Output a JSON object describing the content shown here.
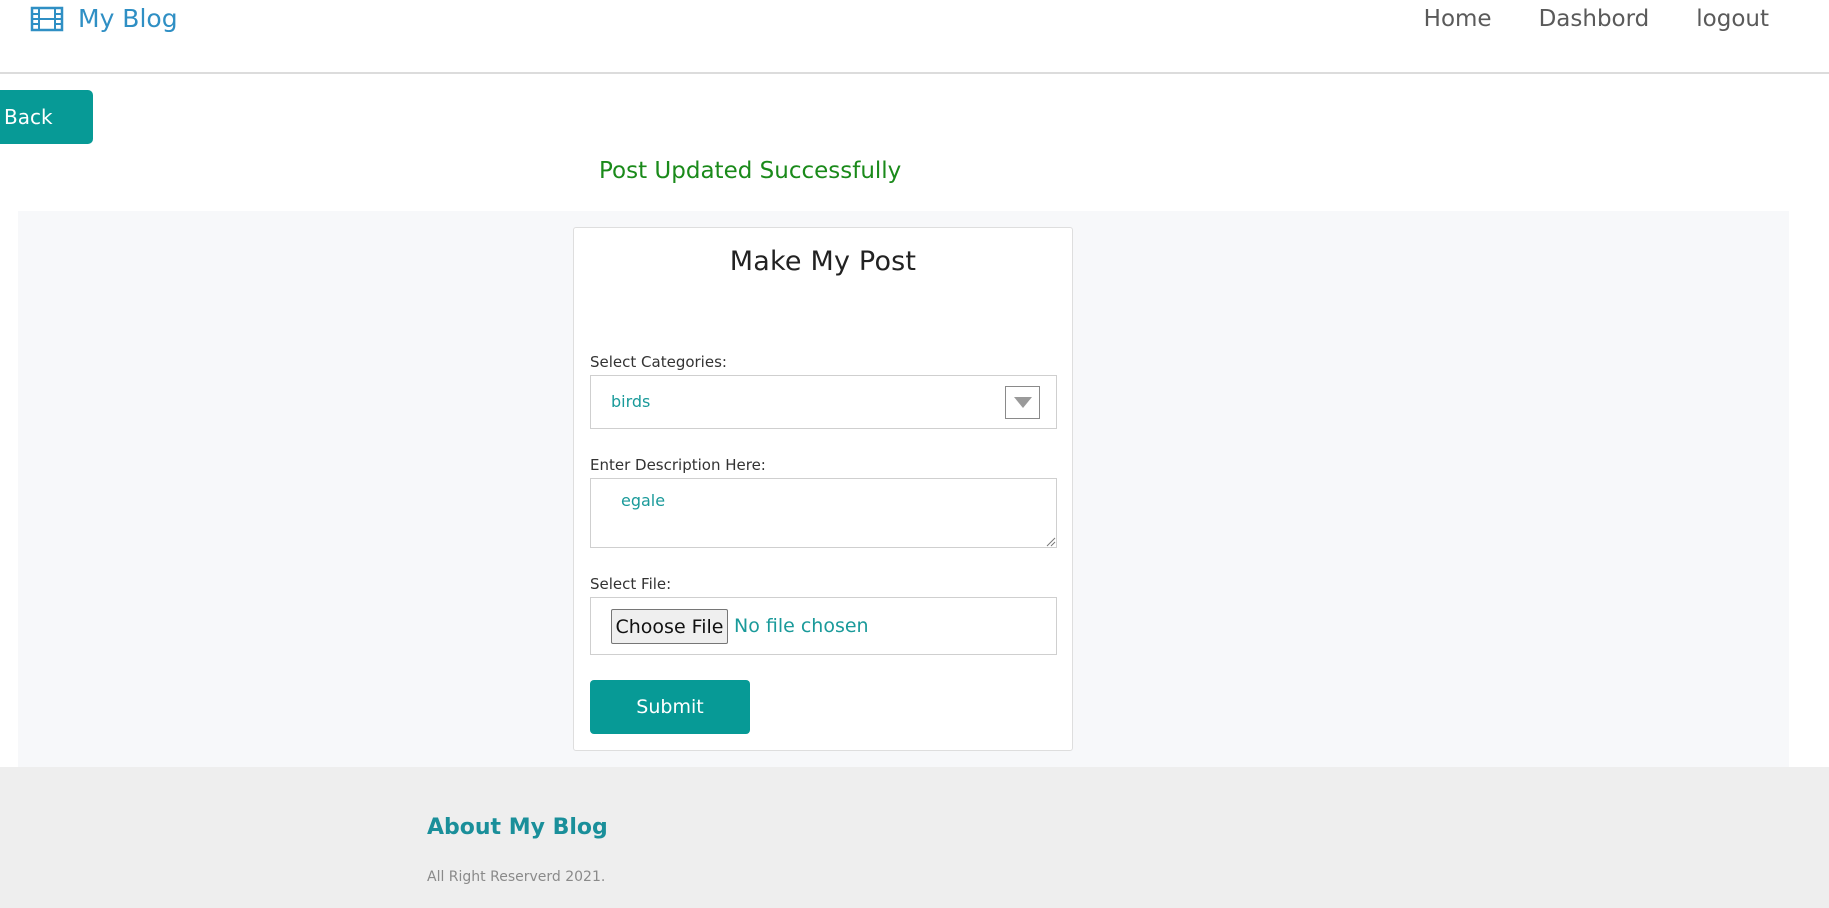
{
  "brand": {
    "name": "My Blog",
    "icon": "film-icon",
    "color": "#2f8fc4"
  },
  "nav": {
    "items": [
      "Home",
      "Dashbord",
      "logout"
    ]
  },
  "back_label": "Back",
  "status_message": "Post Updated Successfully",
  "form": {
    "title": "Make My Post",
    "category_label": "Select Categories:",
    "category_value": "birds",
    "description_label": "Enter Description Here:",
    "description_value": "egale",
    "file_label": "Select File:",
    "choose_file_label": "Choose File",
    "no_file_text": "No file chosen",
    "submit_label": "Submit"
  },
  "footer": {
    "title": "About My Blog",
    "copyright": "All Right Reserverd 2021."
  },
  "colors": {
    "accent": "#079a96",
    "success": "#1a8a1a",
    "footer_bg": "#eeeeee"
  }
}
